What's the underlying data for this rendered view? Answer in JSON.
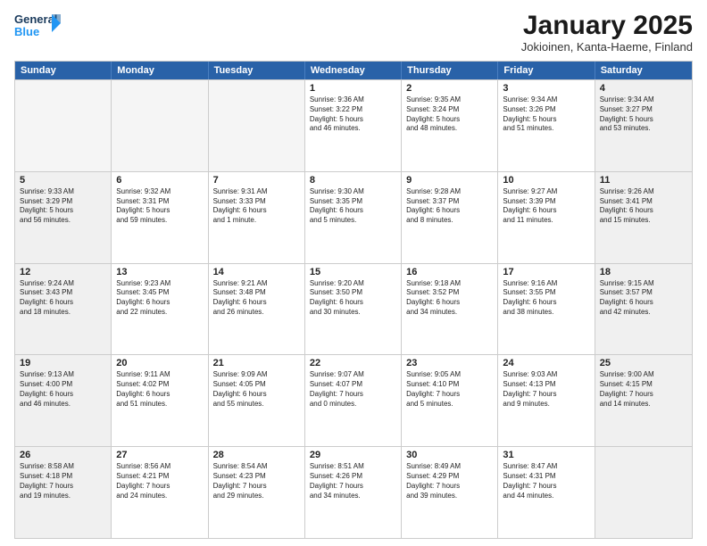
{
  "logo": {
    "line1": "General",
    "line2": "Blue"
  },
  "title": "January 2025",
  "subtitle": "Jokioinen, Kanta-Haeme, Finland",
  "headers": [
    "Sunday",
    "Monday",
    "Tuesday",
    "Wednesday",
    "Thursday",
    "Friday",
    "Saturday"
  ],
  "rows": [
    [
      {
        "day": "",
        "info": "",
        "empty": true
      },
      {
        "day": "",
        "info": "",
        "empty": true
      },
      {
        "day": "",
        "info": "",
        "empty": true
      },
      {
        "day": "1",
        "info": "Sunrise: 9:36 AM\nSunset: 3:22 PM\nDaylight: 5 hours\nand 46 minutes.",
        "empty": false
      },
      {
        "day": "2",
        "info": "Sunrise: 9:35 AM\nSunset: 3:24 PM\nDaylight: 5 hours\nand 48 minutes.",
        "empty": false
      },
      {
        "day": "3",
        "info": "Sunrise: 9:34 AM\nSunset: 3:26 PM\nDaylight: 5 hours\nand 51 minutes.",
        "empty": false
      },
      {
        "day": "4",
        "info": "Sunrise: 9:34 AM\nSunset: 3:27 PM\nDaylight: 5 hours\nand 53 minutes.",
        "empty": false,
        "shaded": true
      }
    ],
    [
      {
        "day": "5",
        "info": "Sunrise: 9:33 AM\nSunset: 3:29 PM\nDaylight: 5 hours\nand 56 minutes.",
        "empty": false,
        "shaded": true
      },
      {
        "day": "6",
        "info": "Sunrise: 9:32 AM\nSunset: 3:31 PM\nDaylight: 5 hours\nand 59 minutes.",
        "empty": false
      },
      {
        "day": "7",
        "info": "Sunrise: 9:31 AM\nSunset: 3:33 PM\nDaylight: 6 hours\nand 1 minute.",
        "empty": false
      },
      {
        "day": "8",
        "info": "Sunrise: 9:30 AM\nSunset: 3:35 PM\nDaylight: 6 hours\nand 5 minutes.",
        "empty": false
      },
      {
        "day": "9",
        "info": "Sunrise: 9:28 AM\nSunset: 3:37 PM\nDaylight: 6 hours\nand 8 minutes.",
        "empty": false
      },
      {
        "day": "10",
        "info": "Sunrise: 9:27 AM\nSunset: 3:39 PM\nDaylight: 6 hours\nand 11 minutes.",
        "empty": false
      },
      {
        "day": "11",
        "info": "Sunrise: 9:26 AM\nSunset: 3:41 PM\nDaylight: 6 hours\nand 15 minutes.",
        "empty": false,
        "shaded": true
      }
    ],
    [
      {
        "day": "12",
        "info": "Sunrise: 9:24 AM\nSunset: 3:43 PM\nDaylight: 6 hours\nand 18 minutes.",
        "empty": false,
        "shaded": true
      },
      {
        "day": "13",
        "info": "Sunrise: 9:23 AM\nSunset: 3:45 PM\nDaylight: 6 hours\nand 22 minutes.",
        "empty": false
      },
      {
        "day": "14",
        "info": "Sunrise: 9:21 AM\nSunset: 3:48 PM\nDaylight: 6 hours\nand 26 minutes.",
        "empty": false
      },
      {
        "day": "15",
        "info": "Sunrise: 9:20 AM\nSunset: 3:50 PM\nDaylight: 6 hours\nand 30 minutes.",
        "empty": false
      },
      {
        "day": "16",
        "info": "Sunrise: 9:18 AM\nSunset: 3:52 PM\nDaylight: 6 hours\nand 34 minutes.",
        "empty": false
      },
      {
        "day": "17",
        "info": "Sunrise: 9:16 AM\nSunset: 3:55 PM\nDaylight: 6 hours\nand 38 minutes.",
        "empty": false
      },
      {
        "day": "18",
        "info": "Sunrise: 9:15 AM\nSunset: 3:57 PM\nDaylight: 6 hours\nand 42 minutes.",
        "empty": false,
        "shaded": true
      }
    ],
    [
      {
        "day": "19",
        "info": "Sunrise: 9:13 AM\nSunset: 4:00 PM\nDaylight: 6 hours\nand 46 minutes.",
        "empty": false,
        "shaded": true
      },
      {
        "day": "20",
        "info": "Sunrise: 9:11 AM\nSunset: 4:02 PM\nDaylight: 6 hours\nand 51 minutes.",
        "empty": false
      },
      {
        "day": "21",
        "info": "Sunrise: 9:09 AM\nSunset: 4:05 PM\nDaylight: 6 hours\nand 55 minutes.",
        "empty": false
      },
      {
        "day": "22",
        "info": "Sunrise: 9:07 AM\nSunset: 4:07 PM\nDaylight: 7 hours\nand 0 minutes.",
        "empty": false
      },
      {
        "day": "23",
        "info": "Sunrise: 9:05 AM\nSunset: 4:10 PM\nDaylight: 7 hours\nand 5 minutes.",
        "empty": false
      },
      {
        "day": "24",
        "info": "Sunrise: 9:03 AM\nSunset: 4:13 PM\nDaylight: 7 hours\nand 9 minutes.",
        "empty": false
      },
      {
        "day": "25",
        "info": "Sunrise: 9:00 AM\nSunset: 4:15 PM\nDaylight: 7 hours\nand 14 minutes.",
        "empty": false,
        "shaded": true
      }
    ],
    [
      {
        "day": "26",
        "info": "Sunrise: 8:58 AM\nSunset: 4:18 PM\nDaylight: 7 hours\nand 19 minutes.",
        "empty": false,
        "shaded": true
      },
      {
        "day": "27",
        "info": "Sunrise: 8:56 AM\nSunset: 4:21 PM\nDaylight: 7 hours\nand 24 minutes.",
        "empty": false
      },
      {
        "day": "28",
        "info": "Sunrise: 8:54 AM\nSunset: 4:23 PM\nDaylight: 7 hours\nand 29 minutes.",
        "empty": false
      },
      {
        "day": "29",
        "info": "Sunrise: 8:51 AM\nSunset: 4:26 PM\nDaylight: 7 hours\nand 34 minutes.",
        "empty": false
      },
      {
        "day": "30",
        "info": "Sunrise: 8:49 AM\nSunset: 4:29 PM\nDaylight: 7 hours\nand 39 minutes.",
        "empty": false
      },
      {
        "day": "31",
        "info": "Sunrise: 8:47 AM\nSunset: 4:31 PM\nDaylight: 7 hours\nand 44 minutes.",
        "empty": false
      },
      {
        "day": "",
        "info": "",
        "empty": true,
        "shaded": true
      }
    ]
  ]
}
